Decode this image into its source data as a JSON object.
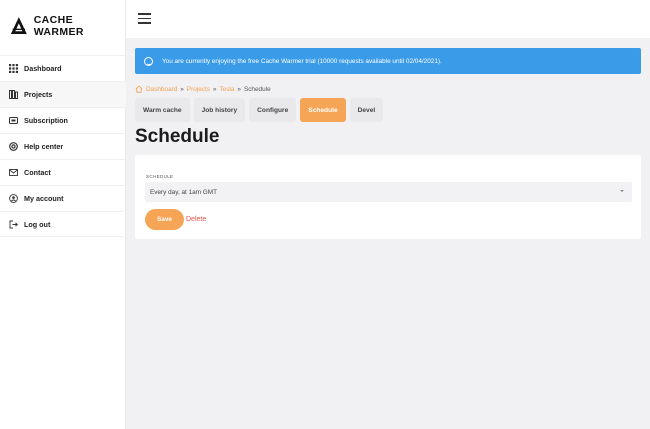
{
  "app": {
    "brand": "CACHE WARMER"
  },
  "sidebar": {
    "items": [
      {
        "label": "Dashboard",
        "icon": "grid-icon"
      },
      {
        "label": "Projects",
        "icon": "projects-icon",
        "active": true
      },
      {
        "label": "Subscription",
        "icon": "ticket-icon"
      },
      {
        "label": "Help center",
        "icon": "lifebuoy-icon"
      },
      {
        "label": "Contact",
        "icon": "envelope-icon"
      },
      {
        "label": "My account",
        "icon": "user-circle-icon"
      },
      {
        "label": "Log out",
        "icon": "logout-icon"
      }
    ]
  },
  "banner": {
    "text": "You are currently enjoying the free Cache Warmer trial (10000 requests available until 02/04/2021).",
    "color": "#3a9be8"
  },
  "breadcrumb": {
    "dashboard": "Dashboard",
    "sep1": "»",
    "projects": "Projects",
    "sep2": "»",
    "project": "Tesla",
    "sep3": "»",
    "current": "Schedule"
  },
  "tabs": [
    {
      "label": "Warm cache"
    },
    {
      "label": "Job history"
    },
    {
      "label": "Configure"
    },
    {
      "label": "Schedule",
      "active": true
    },
    {
      "label": "Devel"
    }
  ],
  "page": {
    "title": "Schedule"
  },
  "form": {
    "schedule_label": "SCHEDULE",
    "schedule_value": "Every day, at 1am GMT",
    "save_label": "Save",
    "delete_label": "Delete"
  },
  "colors": {
    "accent": "#f6a556",
    "danger": "#e1524a",
    "info": "#3a9be8"
  }
}
